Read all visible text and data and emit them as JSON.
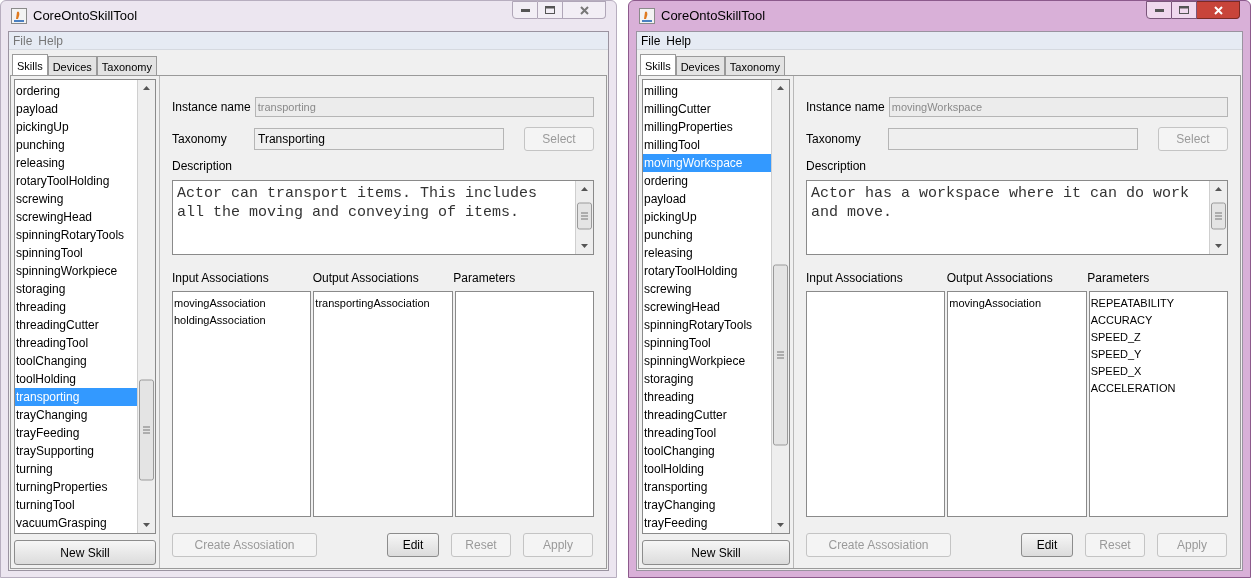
{
  "windows": [
    {
      "title": "CoreOntoSkillTool",
      "active": false,
      "menu": [
        "File",
        "Help"
      ],
      "tabs": [
        {
          "label": "Skills",
          "selected": true
        },
        {
          "label": "Devices",
          "selected": false
        },
        {
          "label": "Taxonomy",
          "selected": false
        }
      ],
      "skills": [
        {
          "label": "ordering",
          "selected": false
        },
        {
          "label": "payload",
          "selected": false
        },
        {
          "label": "pickingUp",
          "selected": false
        },
        {
          "label": "punching",
          "selected": false
        },
        {
          "label": "releasing",
          "selected": false
        },
        {
          "label": "rotaryToolHolding",
          "selected": false
        },
        {
          "label": "screwing",
          "selected": false
        },
        {
          "label": "screwingHead",
          "selected": false
        },
        {
          "label": "spinningRotaryTools",
          "selected": false
        },
        {
          "label": "spinningTool",
          "selected": false
        },
        {
          "label": "spinningWorkpiece",
          "selected": false
        },
        {
          "label": "storaging",
          "selected": false
        },
        {
          "label": "threading",
          "selected": false
        },
        {
          "label": "threadingCutter",
          "selected": false
        },
        {
          "label": "threadingTool",
          "selected": false
        },
        {
          "label": "toolChanging",
          "selected": false
        },
        {
          "label": "toolHolding",
          "selected": false
        },
        {
          "label": "transporting",
          "selected": true
        },
        {
          "label": "trayChanging",
          "selected": false
        },
        {
          "label": "trayFeeding",
          "selected": false
        },
        {
          "label": "traySupporting",
          "selected": false
        },
        {
          "label": "turning",
          "selected": false
        },
        {
          "label": "turningProperties",
          "selected": false
        },
        {
          "label": "turningTool",
          "selected": false
        },
        {
          "label": "vacuumGrasping",
          "selected": false
        }
      ],
      "new_skill_button": "New Skill",
      "instance_name": {
        "label": "Instance name",
        "value": "transporting",
        "disabled": true
      },
      "taxonomy": {
        "label": "Taxonomy",
        "value": "Transporting"
      },
      "select_button": {
        "label": "Select",
        "disabled": true
      },
      "description": {
        "label": "Description",
        "value": "Actor can transport items. This includes all the moving and conveying of items."
      },
      "columns": [
        {
          "header": "Input Associations",
          "items": [
            "movingAssociation",
            "holdingAssociation"
          ]
        },
        {
          "header": "Output Associations",
          "items": [
            "transportingAssociation"
          ]
        },
        {
          "header": "Parameters"
        }
      ],
      "buttons": [
        {
          "label": "Create Assosiation",
          "disabled": true
        },
        {
          "label": "Edit",
          "disabled": false
        },
        {
          "label": "Reset",
          "disabled": true
        },
        {
          "label": "Apply",
          "disabled": true
        }
      ]
    },
    {
      "title": "CoreOntoSkillTool",
      "active": true,
      "menu": [
        "File",
        "Help"
      ],
      "tabs": [
        {
          "label": "Skills",
          "selected": true
        },
        {
          "label": "Devices",
          "selected": false
        },
        {
          "label": "Taxonomy",
          "selected": false
        }
      ],
      "skills": [
        {
          "label": "milling",
          "selected": false
        },
        {
          "label": "millingCutter",
          "selected": false
        },
        {
          "label": "millingProperties",
          "selected": false
        },
        {
          "label": "millingTool",
          "selected": false
        },
        {
          "label": "movingWorkspace",
          "selected": true
        },
        {
          "label": "ordering",
          "selected": false
        },
        {
          "label": "payload",
          "selected": false
        },
        {
          "label": "pickingUp",
          "selected": false
        },
        {
          "label": "punching",
          "selected": false
        },
        {
          "label": "releasing",
          "selected": false
        },
        {
          "label": "rotaryToolHolding",
          "selected": false
        },
        {
          "label": "screwing",
          "selected": false
        },
        {
          "label": "screwingHead",
          "selected": false
        },
        {
          "label": "spinningRotaryTools",
          "selected": false
        },
        {
          "label": "spinningTool",
          "selected": false
        },
        {
          "label": "spinningWorkpiece",
          "selected": false
        },
        {
          "label": "storaging",
          "selected": false
        },
        {
          "label": "threading",
          "selected": false
        },
        {
          "label": "threadingCutter",
          "selected": false
        },
        {
          "label": "threadingTool",
          "selected": false
        },
        {
          "label": "toolChanging",
          "selected": false
        },
        {
          "label": "toolHolding",
          "selected": false
        },
        {
          "label": "transporting",
          "selected": false
        },
        {
          "label": "trayChanging",
          "selected": false
        },
        {
          "label": "trayFeeding",
          "selected": false
        }
      ],
      "new_skill_button": "New Skill",
      "instance_name": {
        "label": "Instance name",
        "value": "movingWorkspace",
        "disabled": true
      },
      "taxonomy": {
        "label": "Taxonomy"
      },
      "select_button": {
        "label": "Select",
        "disabled": true
      },
      "description": {
        "label": "Description",
        "value": "Actor has a workspace where it can do work and move."
      },
      "columns": [
        {
          "header": "Input Associations"
        },
        {
          "header": "Output Associations",
          "items": [
            "movingAssociation"
          ]
        },
        {
          "header": "Parameters",
          "items": [
            "REPEATABILITY",
            "ACCURACY",
            "SPEED_Z",
            "SPEED_Y",
            "SPEED_X",
            "ACCELERATION"
          ]
        }
      ],
      "buttons": [
        {
          "label": "Create Assosiation",
          "disabled": true
        },
        {
          "label": "Edit",
          "disabled": false
        },
        {
          "label": "Reset",
          "disabled": true
        },
        {
          "label": "Apply",
          "disabled": true
        }
      ]
    }
  ]
}
